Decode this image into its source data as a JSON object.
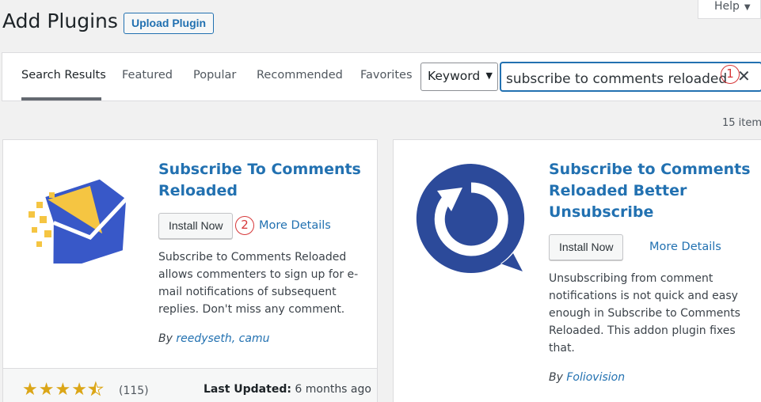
{
  "page": {
    "title": "Add Plugins",
    "upload_button": "Upload Plugin",
    "help_tab": "Help",
    "items_count": "15 item"
  },
  "filter": {
    "tabs": [
      "Search Results",
      "Featured",
      "Popular",
      "Recommended",
      "Favorites"
    ],
    "active_tab": "Search Results",
    "search_type": "Keyword",
    "search_value": "subscribe to comments reloaded"
  },
  "markers": [
    "1",
    "2"
  ],
  "plugins": [
    {
      "name": "Subscribe To Comments Reloaded",
      "name_lines": [
        "Subscribe To Comments",
        "Reloaded"
      ],
      "install_label": "Install Now",
      "details_label": "More Details",
      "description_lines": [
        "Subscribe to Comments Reloaded",
        "allows commenters to sign up for e-",
        "mail notifications of subsequent",
        "replies. Don't miss any comment."
      ],
      "author_prefix": "By",
      "author": "reedyseth, camu",
      "rating": 4.5,
      "rating_count": "(115)",
      "last_updated_label": "Last Updated:",
      "last_updated_value": "6 months ago",
      "colors": {
        "envelope": "#3858c8",
        "accent": "#f5c542"
      }
    },
    {
      "name": "Subscribe to Comments Reloaded Better Unsubscribe",
      "name_lines": [
        "Subscribe to Comments",
        "Reloaded Better",
        "Unsubscribe"
      ],
      "install_label": "Install Now",
      "details_label": "More Details",
      "description_lines": [
        "Unsubscribing from comment",
        "notifications is not quick and easy",
        "enough in Subscribe to Comments",
        "Reloaded. This addon plugin fixes",
        "that."
      ],
      "author_prefix": "By",
      "author": "Foliovision",
      "colors": {
        "icon": "#2c4a9a"
      }
    }
  ],
  "icons": {
    "help_dropdown": "chevron-down-icon",
    "select_dropdown": "chevron-down-icon",
    "clear_search": "close-icon",
    "plugin1": "envelope-icon",
    "plugin2": "refresh-bubble-icon",
    "rating": "star-icon"
  }
}
